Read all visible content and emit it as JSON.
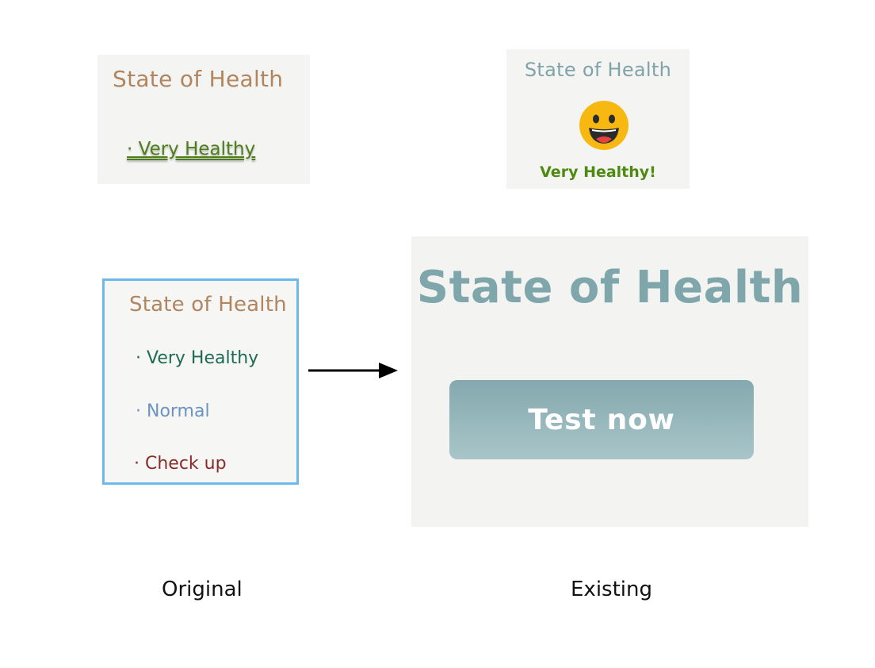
{
  "original_small": {
    "title": "State of Health",
    "item": "· Very Healthy"
  },
  "existing_small": {
    "title": "State of Health",
    "icon": "grinning-face-emoji",
    "caption": "Very Healthy!"
  },
  "original_list": {
    "title": "State of Health",
    "items": [
      "· Very Healthy",
      "· Normal",
      "· Check up"
    ]
  },
  "existing_large": {
    "title": "State of Health",
    "button_label": "Test now"
  },
  "captions": {
    "left": "Original",
    "right": "Existing"
  },
  "colors": {
    "title_brown": "#b0855f",
    "title_teal": "#7fa3a8",
    "healthy_green": "#4f7f1d",
    "list_green": "#1d6b55",
    "normal_blue": "#6a94c4",
    "checkup_red": "#8a2b2b",
    "frame_blue": "#6cb9ea"
  }
}
